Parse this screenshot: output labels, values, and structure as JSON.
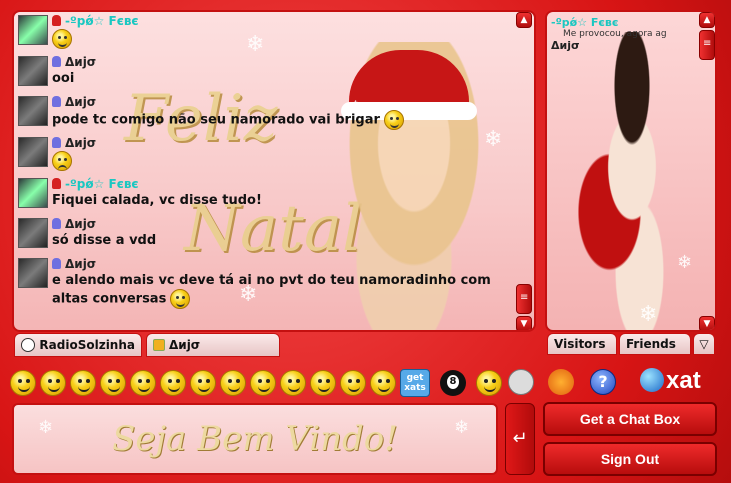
{
  "messages": [
    {
      "name": "-ºpǿ☆ Fєвє",
      "text": "",
      "style": "teal"
    },
    {
      "name": "Δиjσ",
      "text": "ooi",
      "style": "dark"
    },
    {
      "name": "Δиjσ",
      "text": "pode tc comigo não seu namorado vai brigar",
      "style": "dark"
    },
    {
      "name": "Δиjσ",
      "text": "",
      "style": "dark"
    },
    {
      "name": "-ºpǿ☆ Fєвє",
      "text": "Fiquei calada, vc disse tudo!",
      "style": "teal"
    },
    {
      "name": "Δиjσ",
      "text": "só disse a vdd",
      "style": "dark"
    },
    {
      "name": "Δиjσ",
      "text": "e alendo mais vc deve tá ai no pvt do teu namoradinho com",
      "text2": "altas conversas",
      "style": "dark"
    }
  ],
  "chat_tabs": {
    "main": "RadioSolzinha",
    "private": "Δиjσ"
  },
  "side_users": [
    {
      "name": "-ºpǿ☆ Fєвє",
      "status": "Me provocou, agora ag"
    },
    {
      "name": "Δиjσ",
      "status": ""
    }
  ],
  "side_tabs": {
    "visitors": "Visitors",
    "friends": "Friends"
  },
  "smileys": {
    "get_xats": "get xats"
  },
  "input": {
    "welcome_art": "Seja Bem Vindo!"
  },
  "buttons": {
    "get_chat_box": "Get a Chat Box",
    "sign_out": "Sign Out"
  },
  "art": {
    "chat_bg_line1": "Feliz",
    "chat_bg_line2": "Natal"
  },
  "colors": {
    "frame": "#e11b1b",
    "name_teal": "#1bc7c1"
  }
}
